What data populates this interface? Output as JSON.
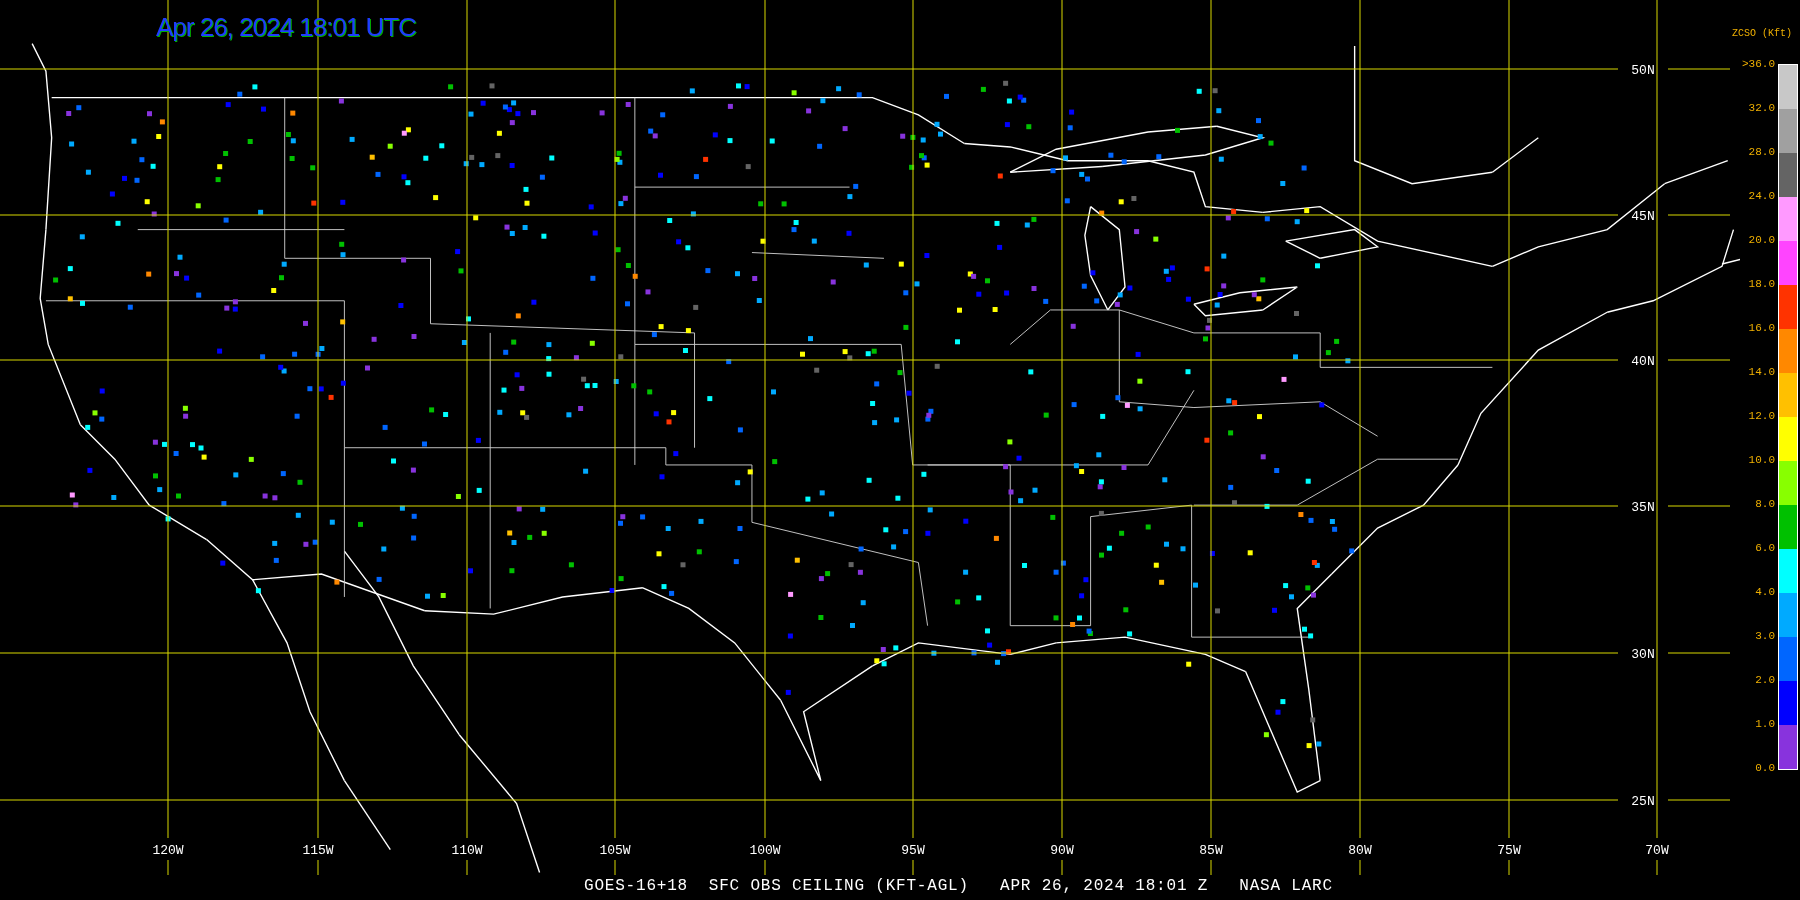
{
  "map": {
    "title": "Apr 26, 2024 18:01 UTC",
    "latitude_labels": [
      "50N",
      "45N",
      "40N",
      "35N",
      "30N",
      "25N"
    ],
    "longitude_labels": [
      "120W",
      "115W",
      "110W",
      "105W",
      "100W",
      "95W",
      "90W",
      "85W",
      "80W",
      "75W",
      "70W"
    ]
  },
  "legend": {
    "title": "ZCSO (Kft)",
    "labels": [
      ">36.0",
      "32.0",
      "28.0",
      "24.0",
      "20.0",
      "18.0",
      "16.0",
      "14.0",
      "12.0",
      "10.0",
      "8.0",
      "6.0",
      "4.0",
      "3.0",
      "2.0",
      "1.0",
      "0.0"
    ],
    "bins": [
      {
        "color": "#c8c8c8"
      },
      {
        "color": "#a0a0a0"
      },
      {
        "color": "#646464"
      },
      {
        "color": "#ff99ff"
      },
      {
        "color": "#ff44ff"
      },
      {
        "color": "#ff3300"
      },
      {
        "color": "#ff8800"
      },
      {
        "color": "#ffc000"
      },
      {
        "color": "#ffff00"
      },
      {
        "color": "#88ff00"
      },
      {
        "color": "#00c000"
      },
      {
        "color": "#00ffff"
      },
      {
        "color": "#00aaff"
      },
      {
        "color": "#0066ff"
      },
      {
        "color": "#0000ff"
      },
      {
        "color": "#8833dd"
      }
    ]
  },
  "footer": "GOES-16+18  SFC OBS CEILING (KFT-AGL)   APR 26, 2024 18:01 Z   NASA LARC"
}
